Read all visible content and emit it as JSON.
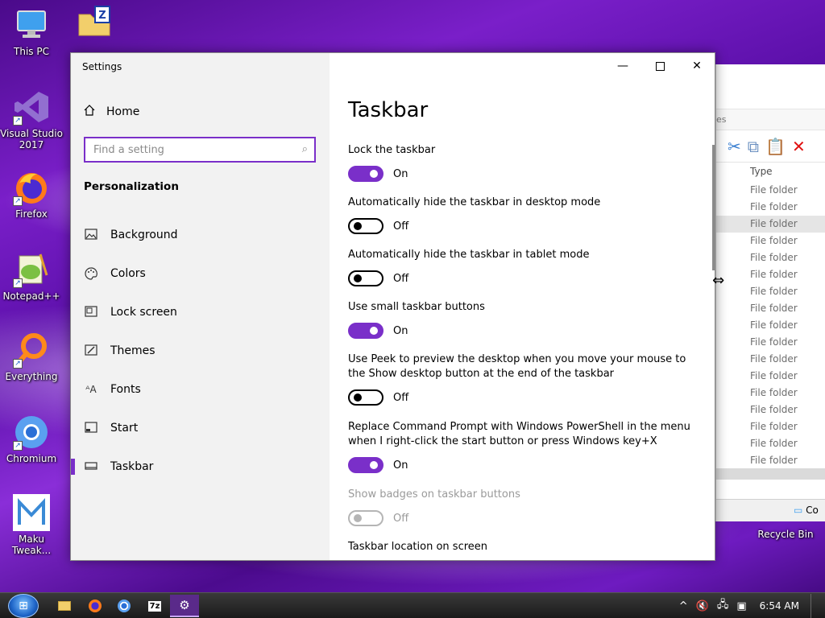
{
  "desktop": {
    "icons": [
      {
        "label": "This PC",
        "icon": "computer-icon"
      },
      {
        "label": "Visual Studio 2017",
        "icon": "visual-studio-icon"
      },
      {
        "label": "Firefox",
        "icon": "firefox-icon"
      },
      {
        "label": "Notepad++",
        "icon": "notepad-plus-plus-icon"
      },
      {
        "label": "Everything",
        "icon": "everything-search-icon"
      },
      {
        "label": "Chromium",
        "icon": "chromium-icon"
      },
      {
        "label": "Maku Tweak...",
        "icon": "maku-tweaker-icon"
      },
      {
        "label": "Recycle Bin",
        "icon": "recycle-bin-icon"
      }
    ]
  },
  "explorer": {
    "address_partial": "es",
    "column_type": "Type",
    "rows": [
      "File folder",
      "File folder",
      "File folder",
      "File folder",
      "File folder",
      "File folder",
      "File folder",
      "File folder",
      "File folder",
      "File folder",
      "File folder",
      "File folder",
      "File folder",
      "File folder",
      "File folder",
      "File folder",
      "File folder"
    ],
    "status_partial": "Co"
  },
  "settings": {
    "window_title": "Settings",
    "nav_home": "Home",
    "search_placeholder": "Find a setting",
    "section": "Personalization",
    "nav_items": [
      {
        "label": "Background",
        "icon": "picture-icon"
      },
      {
        "label": "Colors",
        "icon": "palette-icon"
      },
      {
        "label": "Lock screen",
        "icon": "lock-screen-icon"
      },
      {
        "label": "Themes",
        "icon": "themes-icon"
      },
      {
        "label": "Fonts",
        "icon": "fonts-icon"
      },
      {
        "label": "Start",
        "icon": "start-icon"
      },
      {
        "label": "Taskbar",
        "icon": "taskbar-icon"
      }
    ],
    "active_nav": "Taskbar",
    "page_title": "Taskbar",
    "options": [
      {
        "label": "Lock the taskbar",
        "state": "On",
        "enabled": true
      },
      {
        "label": "Automatically hide the taskbar in desktop mode",
        "state": "Off",
        "enabled": true
      },
      {
        "label": "Automatically hide the taskbar in tablet mode",
        "state": "Off",
        "enabled": true
      },
      {
        "label": "Use small taskbar buttons",
        "state": "On",
        "enabled": true
      },
      {
        "label": "Use Peek to preview the desktop when you move your mouse to the Show desktop button at the end of the taskbar",
        "state": "Off",
        "enabled": true
      },
      {
        "label": "Replace Command Prompt with Windows PowerShell in the menu when I right-click the start button or press Windows key+X",
        "state": "On",
        "enabled": true
      },
      {
        "label": "Show badges on taskbar buttons",
        "state": "Off",
        "enabled": false
      }
    ],
    "next_section_label": "Taskbar location on screen",
    "accent_color": "#7a2fc9"
  },
  "taskbar": {
    "apps": [
      {
        "icon": "file-explorer-icon"
      },
      {
        "icon": "firefox-icon"
      },
      {
        "icon": "chromium-icon"
      },
      {
        "icon": "seven-zip-icon",
        "text": "7z"
      },
      {
        "icon": "settings-gear-icon",
        "active": true
      }
    ],
    "clock": "6:54 AM"
  }
}
